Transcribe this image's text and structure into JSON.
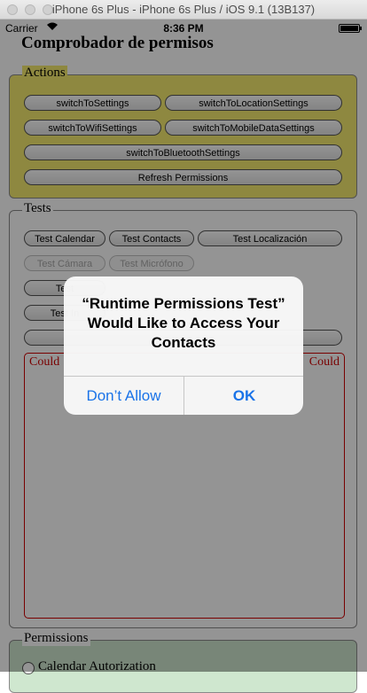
{
  "window": {
    "title": "iPhone 6s Plus - iPhone 6s Plus / iOS 9.1 (13B137)"
  },
  "status_bar": {
    "carrier": "Carrier",
    "wifi_icon": "wifi-icon",
    "time": "8:36 PM",
    "battery_icon": "battery-icon"
  },
  "app": {
    "title": "Comprobador de permisos",
    "actions": {
      "label": "Actions",
      "buttons": [
        "switchToSettings",
        "switchToLocationSettings",
        "switchToWifiSettings",
        "switchToMobileDataSettings",
        "switchToBluetoothSettings",
        "Refresh Permissions"
      ]
    },
    "tests": {
      "label": "Tests",
      "buttons": [
        "Test Calendar",
        "Test Contacts",
        "Test Localización",
        "Test Cámara",
        "Test Micrófono",
        "Test",
        "Test In"
      ],
      "output_left": "Could",
      "output_right": "Could"
    },
    "permissions": {
      "label": "Permissions",
      "calendar": "Calendar Autorization"
    }
  },
  "alert": {
    "message": "“Runtime Permissions Test” Would Like to Access Your Contacts",
    "deny": "Don’t Allow",
    "ok": "OK"
  },
  "colors": {
    "actions_bg": "#f4eb6e",
    "permissions_bg": "#cfe7cf",
    "output_border": "#d00000",
    "alert_button": "#1a73e8"
  }
}
